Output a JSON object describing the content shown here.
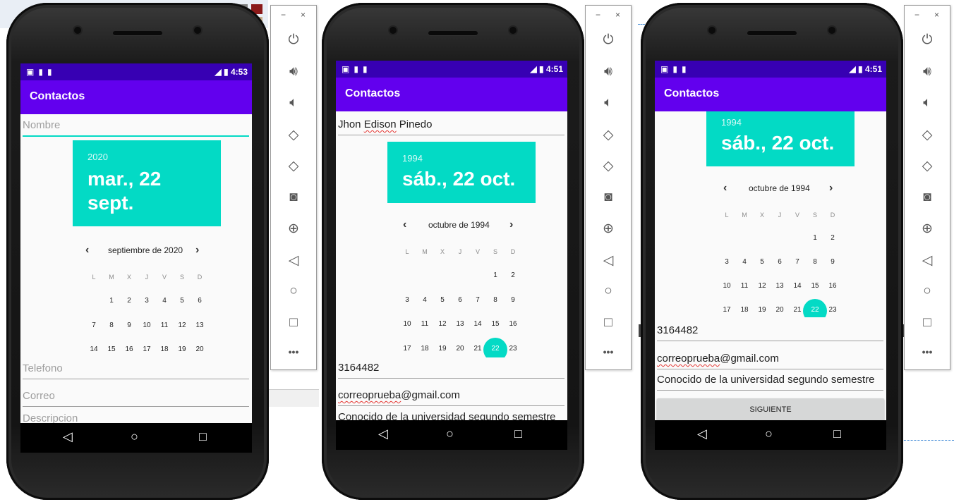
{
  "phones": [
    {
      "status_time": "4:53",
      "app_title": "Contactos",
      "name_value": "Nombre",
      "picker": {
        "year": "2020",
        "date_line1": "mar., 22",
        "date_line2": "sept.",
        "month_label": "septiembre de 2020"
      },
      "weekdays": [
        "L",
        "M",
        "X",
        "J",
        "V",
        "S",
        "D"
      ],
      "phone_value": "Telefono",
      "email_value": "Correo",
      "desc_value": "Descripcion"
    },
    {
      "status_time": "4:51",
      "app_title": "Contactos",
      "name_first": "Jhon ",
      "name_mid": "Edison",
      "name_last": " Pinedo",
      "picker": {
        "year": "1994",
        "date_line1": "sáb., 22 oct.",
        "month_label": "octubre de 1994"
      },
      "weekdays": [
        "L",
        "M",
        "X",
        "J",
        "V",
        "S",
        "D"
      ],
      "phone_value": "3164482",
      "email_user": "correoprueba",
      "email_domain": "@gmail.com",
      "desc_value": "Conocido de la universidad segundo semestre"
    },
    {
      "status_time": "4:51",
      "app_title": "Contactos",
      "picker": {
        "year": "1994",
        "date_line1": "sáb., 22 oct.",
        "month_label": "octubre de 1994"
      },
      "weekdays": [
        "L",
        "M",
        "X",
        "J",
        "V",
        "S",
        "D"
      ],
      "phone_value": "3164482",
      "email_user": "correoprueba",
      "email_domain": "@gmail.com",
      "desc_value": "Conocido de la universidad segundo semestre",
      "next_button": "SIGUIENTE"
    }
  ],
  "calendar_sept_2020": [
    [
      "",
      "1",
      "2",
      "3",
      "4",
      "5",
      "6"
    ],
    [
      "7",
      "8",
      "9",
      "10",
      "11",
      "12",
      "13"
    ],
    [
      "14",
      "15",
      "16",
      "17",
      "18",
      "19",
      "20"
    ]
  ],
  "calendar_oct_1994": [
    [
      "",
      "",
      "",
      "",
      "",
      "1",
      "2"
    ],
    [
      "3",
      "4",
      "5",
      "6",
      "7",
      "8",
      "9"
    ],
    [
      "10",
      "11",
      "12",
      "13",
      "14",
      "15",
      "16"
    ],
    [
      "17",
      "18",
      "19",
      "20",
      "21",
      "22",
      "23"
    ]
  ],
  "emulator_toolbar": {
    "window_controls": [
      "−",
      "×"
    ],
    "tools": [
      "power-icon",
      "volume-up-icon",
      "volume-down-icon",
      "rotate-left-icon",
      "rotate-right-icon",
      "camera-icon",
      "zoom-icon",
      "back-icon",
      "home-icon",
      "overview-icon",
      "more-icon"
    ]
  },
  "colors": {
    "status_bar": "#3700b3",
    "app_bar": "#6200ee",
    "accent": "#03dac5",
    "nav_bar": "#000000"
  }
}
